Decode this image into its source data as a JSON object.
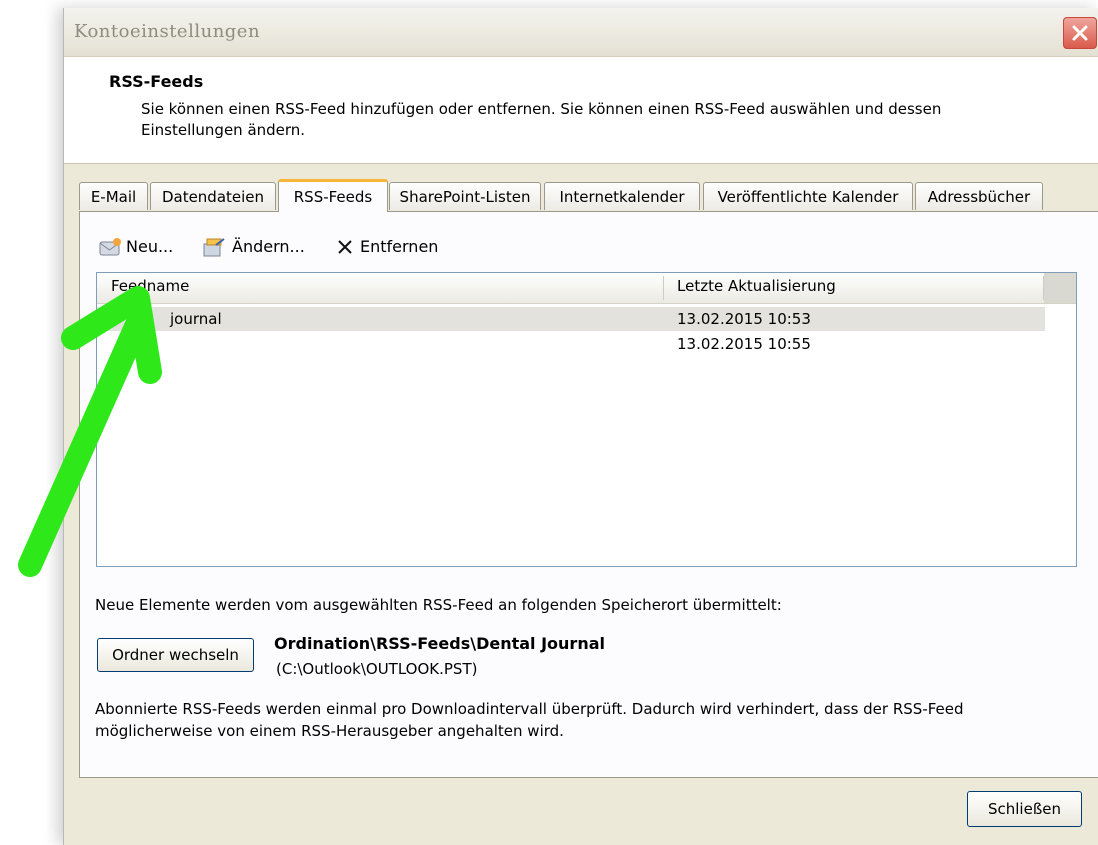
{
  "window": {
    "title": "Kontoeinstellungen"
  },
  "header": {
    "title": "RSS-Feeds",
    "description": "Sie können einen RSS-Feed hinzufügen oder entfernen. Sie können einen RSS-Feed auswählen und dessen Einstellungen ändern."
  },
  "tabs": [
    "E-Mail",
    "Datendateien",
    "RSS-Feeds",
    "SharePoint-Listen",
    "Internetkalender",
    "Veröffentlichte Kalender",
    "Adressbücher"
  ],
  "active_tab": "RSS-Feeds",
  "toolbar": {
    "new_label": "Neu...",
    "edit_label": "Ändern...",
    "remove_label": "Entfernen"
  },
  "list": {
    "columns": [
      "Feedname",
      "Letzte Aktualisierung"
    ],
    "rows": [
      {
        "name": "journal",
        "updated": "13.02.2015 10:53",
        "selected": true
      },
      {
        "name": "",
        "updated": "13.02.2015 10:55",
        "selected": false
      }
    ]
  },
  "delivery": {
    "info": "Neue Elemente werden vom ausgewählten RSS-Feed an folgenden Speicherort übermittelt:",
    "change_folder_label": "Ordner wechseln",
    "folder_path": "Ordination\\RSS-Feeds\\Dental Journal",
    "file_path": "(C:\\Outlook\\OUTLOOK.PST)"
  },
  "note": "Abonnierte RSS-Feeds werden einmal pro Downloadintervall überprüft. Dadurch wird verhindert, dass der RSS-Feed möglicherweise von einem RSS-Herausgeber angehalten wird.",
  "footer": {
    "close_label": "Schließen"
  },
  "colors": {
    "arrow": "#2ee81a",
    "tab_active_accent": "#f9b43a",
    "dialog_bg": "#ece9d8"
  }
}
